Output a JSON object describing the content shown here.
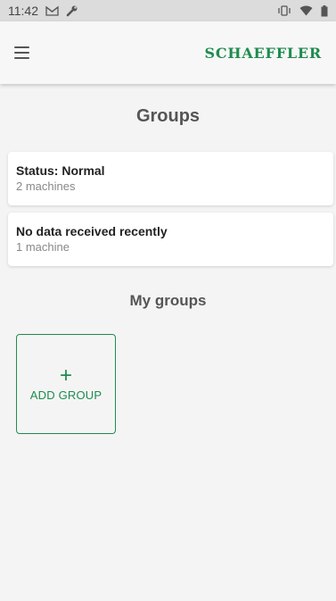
{
  "status_bar": {
    "time": "11:42",
    "left_icons": [
      "gmail-icon",
      "wrench-icon"
    ],
    "right_icons": [
      "vibrate-icon",
      "wifi-icon",
      "battery-icon"
    ]
  },
  "app_bar": {
    "brand": "SCHAEFFLER",
    "brand_color": "#1e8c4e",
    "menu_icon": "menu-icon"
  },
  "main": {
    "title": "Groups",
    "groups": [
      {
        "title": "Status: Normal",
        "subtitle": "2 machines"
      },
      {
        "title": "No data received recently",
        "subtitle": "1 machine"
      }
    ],
    "my_groups_title": "My groups",
    "add_group": {
      "icon": "plus-icon",
      "label": "ADD GROUP"
    }
  }
}
